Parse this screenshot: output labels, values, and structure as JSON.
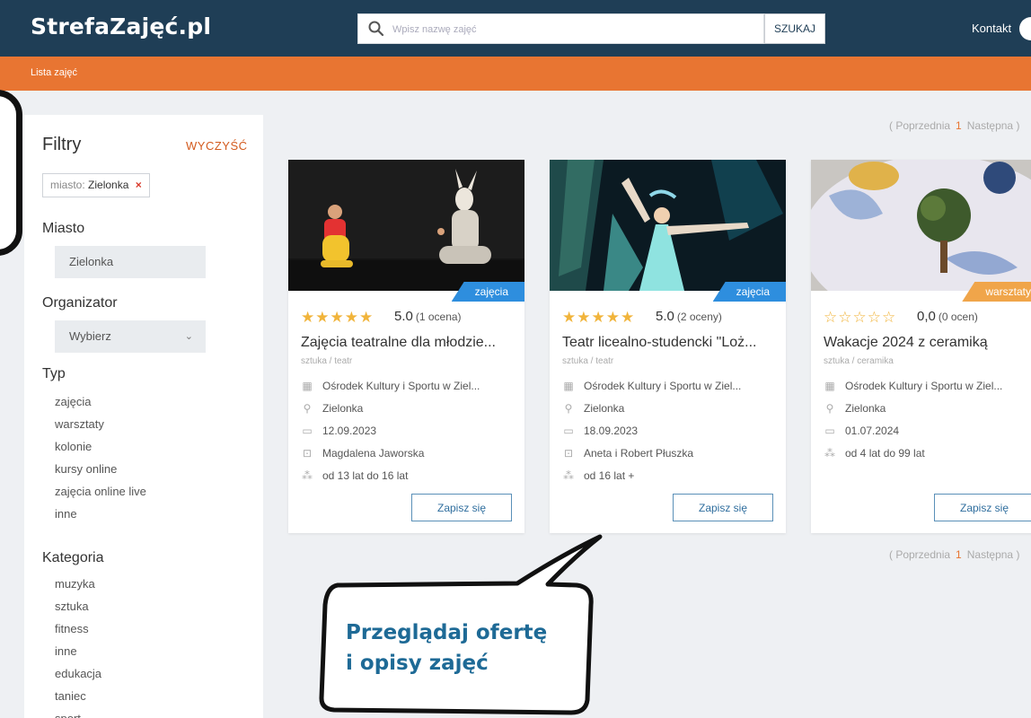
{
  "header": {
    "logo": "StrefaZajęć.pl",
    "search_placeholder": "Wpisz nazwę zajęć",
    "search_button": "SZUKAJ",
    "contact": "Kontakt"
  },
  "breadcrumb": "Lista zajęć",
  "filters": {
    "title": "Filtry",
    "clear": "WYCZYŚĆ",
    "chip_key": "miasto:",
    "chip_value": "Zielonka",
    "chip_remove": "×",
    "city": {
      "title": "Miasto",
      "value": "Zielonka"
    },
    "organizer": {
      "title": "Organizator",
      "value": "Wybierz"
    },
    "type": {
      "title": "Typ",
      "options": [
        "zajęcia",
        "warsztaty",
        "kolonie",
        "kursy online",
        "zajęcia online live",
        "inne"
      ]
    },
    "category": {
      "title": "Kategoria",
      "options": [
        "muzyka",
        "sztuka",
        "fitness",
        "inne",
        "edukacja",
        "taniec",
        "sport"
      ]
    }
  },
  "pagination": {
    "prev": "( Poprzednia",
    "current": "1",
    "next": "Następna )"
  },
  "cards": [
    {
      "badge": "zajęcia",
      "badge_color": "#2e8ede",
      "stars": "★★★★★",
      "rating_value": "5.0",
      "rating_count": "(1 ocena)",
      "title": "Zajęcia teatralne dla młodzie...",
      "category": "sztuka / teatr",
      "organizer": "Ośrodek Kultury i Sportu w Ziel...",
      "city": "Zielonka",
      "date": "12.09.2023",
      "teacher": "Magdalena Jaworska",
      "age": "od 13 lat do 16 lat",
      "button": "Zapisz się"
    },
    {
      "badge": "zajęcia",
      "badge_color": "#2e8ede",
      "stars": "★★★★★",
      "rating_value": "5.0",
      "rating_count": "(2 oceny)",
      "title": "Teatr licealno-studencki \"Loż...",
      "category": "sztuka / teatr",
      "organizer": "Ośrodek Kultury i Sportu w Ziel...",
      "city": "Zielonka",
      "date": "18.09.2023",
      "teacher": "Aneta i Robert Płuszka",
      "age": "od 16 lat +",
      "button": "Zapisz się"
    },
    {
      "badge": "warsztaty",
      "badge_color": "#f0a54a",
      "stars": "☆☆☆☆☆",
      "rating_value": "0,0",
      "rating_count": "(0 ocen)",
      "title": "Wakacje 2024 z ceramiką",
      "category": "sztuka / ceramika",
      "organizer": "Ośrodek Kultury i Sportu w Ziel...",
      "city": "Zielonka",
      "date": "01.07.2024",
      "age": "od 4 lat do 99 lat",
      "button": "Zapisz się"
    }
  ],
  "callout": {
    "line1": "Przeglądaj ofertę",
    "line2": "i opisy zajęć"
  }
}
